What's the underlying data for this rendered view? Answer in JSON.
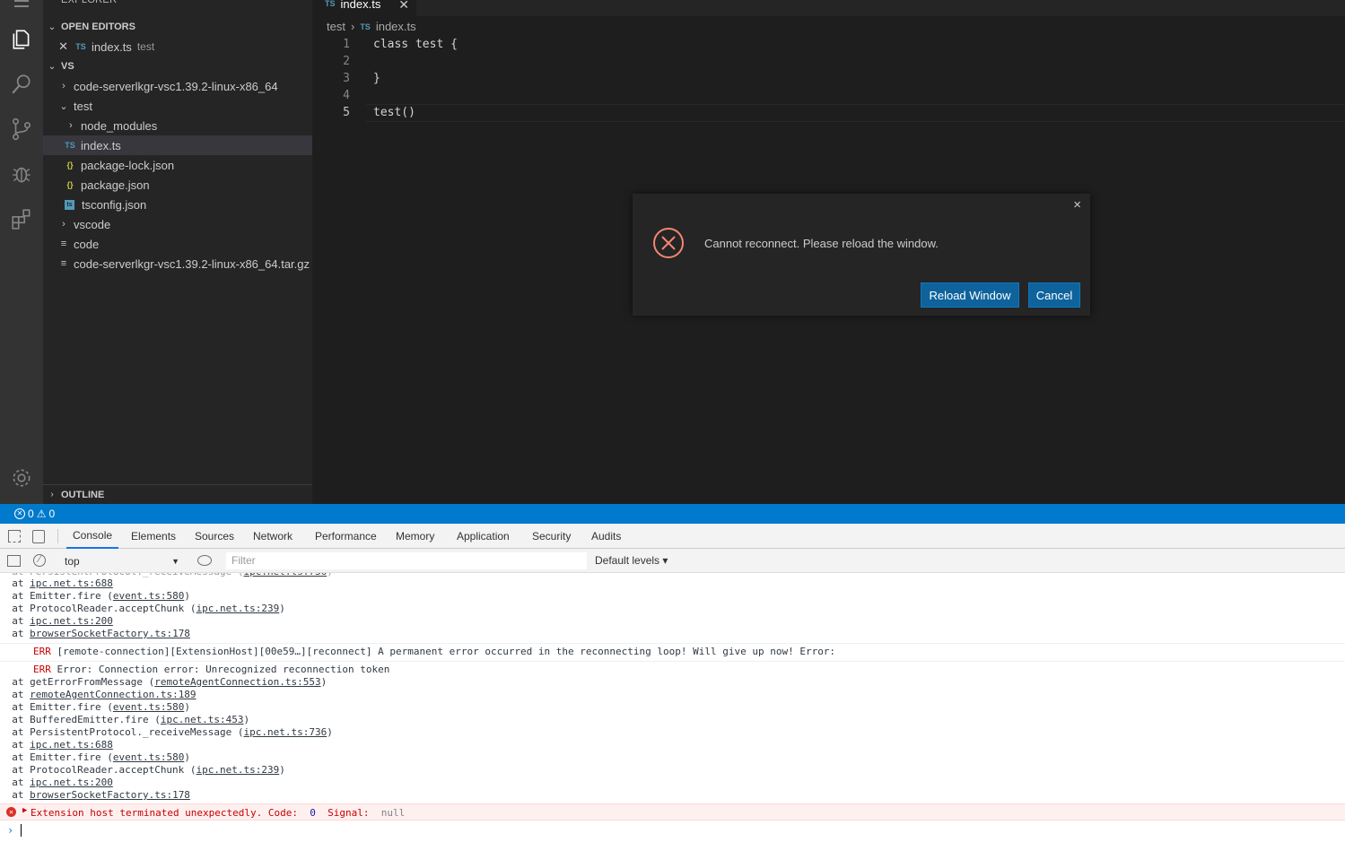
{
  "sidebar": {
    "title": "EXPLORER",
    "open_editors_label": "OPEN EDITORS",
    "open_editor": {
      "name": "index.ts",
      "dir": "test",
      "icon": "TS"
    },
    "root_label": "VS",
    "tree": [
      {
        "label": "code-serverlkgr-vsc1.39.2-linux-x86_64",
        "kind": "folder-collapsed"
      },
      {
        "label": "test",
        "kind": "folder-expanded"
      },
      {
        "label": "node_modules",
        "kind": "folder-collapsed"
      },
      {
        "label": "index.ts",
        "kind": "ts"
      },
      {
        "label": "package-lock.json",
        "kind": "json"
      },
      {
        "label": "package.json",
        "kind": "json"
      },
      {
        "label": "tsconfig.json",
        "kind": "tsconfig"
      },
      {
        "label": "vscode",
        "kind": "folder-collapsed"
      },
      {
        "label": "code",
        "kind": "file"
      },
      {
        "label": "code-serverlkgr-vsc1.39.2-linux-x86_64.tar.gz",
        "kind": "file"
      }
    ],
    "outline_label": "OUTLINE"
  },
  "editor": {
    "tab_label": "index.ts",
    "tab_icon": "TS",
    "breadcrumb": [
      "test",
      "index.ts"
    ],
    "lines": [
      {
        "num": "1",
        "text": "class test {"
      },
      {
        "num": "2",
        "text": ""
      },
      {
        "num": "3",
        "text": "}"
      },
      {
        "num": "4",
        "text": ""
      },
      {
        "num": "5",
        "text": "test()"
      }
    ]
  },
  "dialog": {
    "message": "Cannot reconnect. Please reload the window.",
    "reload_label": "Reload Window",
    "cancel_label": "Cancel",
    "close_glyph": "×"
  },
  "status": {
    "errors": "0",
    "warnings": "0"
  },
  "devtools": {
    "tabs": [
      "Console",
      "Elements",
      "Sources",
      "Network",
      "Performance",
      "Memory",
      "Application",
      "Security",
      "Audits"
    ],
    "context": "top",
    "filter_placeholder": "Filter",
    "levels": "Default levels ▾",
    "lines_a": [
      [
        "at ",
        "ipc.net.ts:688",
        ""
      ],
      [
        "at Emitter.fire (",
        "event.ts:580",
        ")"
      ],
      [
        "at ProtocolReader.acceptChunk (",
        "ipc.net.ts:239",
        ")"
      ],
      [
        "at ",
        "ipc.net.ts:200",
        ""
      ],
      [
        "at ",
        "browserSocketFactory.ts:178",
        ""
      ]
    ],
    "err1": "[remote-connection][ExtensionHost][00e59…][reconnect] A permanent error occurred in the reconnecting loop! Will give up now! Error:",
    "err2": "Error: Connection error: Unrecognized reconnection token",
    "err_tag": "ERR",
    "lines_b": [
      [
        "at getErrorFromMessage (",
        "remoteAgentConnection.ts:553",
        ")"
      ],
      [
        "at ",
        "remoteAgentConnection.ts:189",
        ""
      ],
      [
        "at Emitter.fire (",
        "event.ts:580",
        ")"
      ],
      [
        "at BufferedEmitter.fire (",
        "ipc.net.ts:453",
        ")"
      ],
      [
        "at PersistentProtocol._receiveMessage (",
        "ipc.net.ts:736",
        ")"
      ],
      [
        "at ",
        "ipc.net.ts:688",
        ""
      ],
      [
        "at Emitter.fire (",
        "event.ts:580",
        ")"
      ],
      [
        "at ProtocolReader.acceptChunk (",
        "ipc.net.ts:239",
        ")"
      ],
      [
        "at ",
        "ipc.net.ts:200",
        ""
      ],
      [
        "at ",
        "browserSocketFactory.ts:178",
        ""
      ]
    ],
    "final_error": {
      "text": "Extension host terminated unexpectedly. Code:",
      "code": "0",
      "signal_label": "Signal:",
      "signal": "null"
    }
  }
}
